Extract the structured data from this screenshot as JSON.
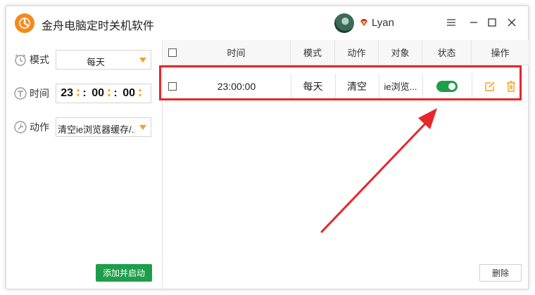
{
  "app": {
    "title": "金舟电脑定时关机软件",
    "brand_color": "#f28b1e"
  },
  "user": {
    "name": "Lyan"
  },
  "form": {
    "mode_label": "模式",
    "mode_value": "每天",
    "time_label": "时间",
    "time_hour": "23",
    "time_minute": "00",
    "time_second": "00",
    "action_label": "动作",
    "action_value": "清空ie浏览器缓存/..."
  },
  "buttons": {
    "add_start": "添加并启动",
    "delete": "删除"
  },
  "table": {
    "headers": [
      "时间",
      "模式",
      "动作",
      "对象",
      "状态",
      "操作"
    ],
    "rows": [
      {
        "time": "23:00:00",
        "mode": "每天",
        "action": "清空",
        "target": "ie浏览...",
        "status_on": true
      }
    ]
  },
  "colors": {
    "accent": "#f0a028",
    "green": "#1e9e4a",
    "annotation_red": "#e8262b"
  }
}
